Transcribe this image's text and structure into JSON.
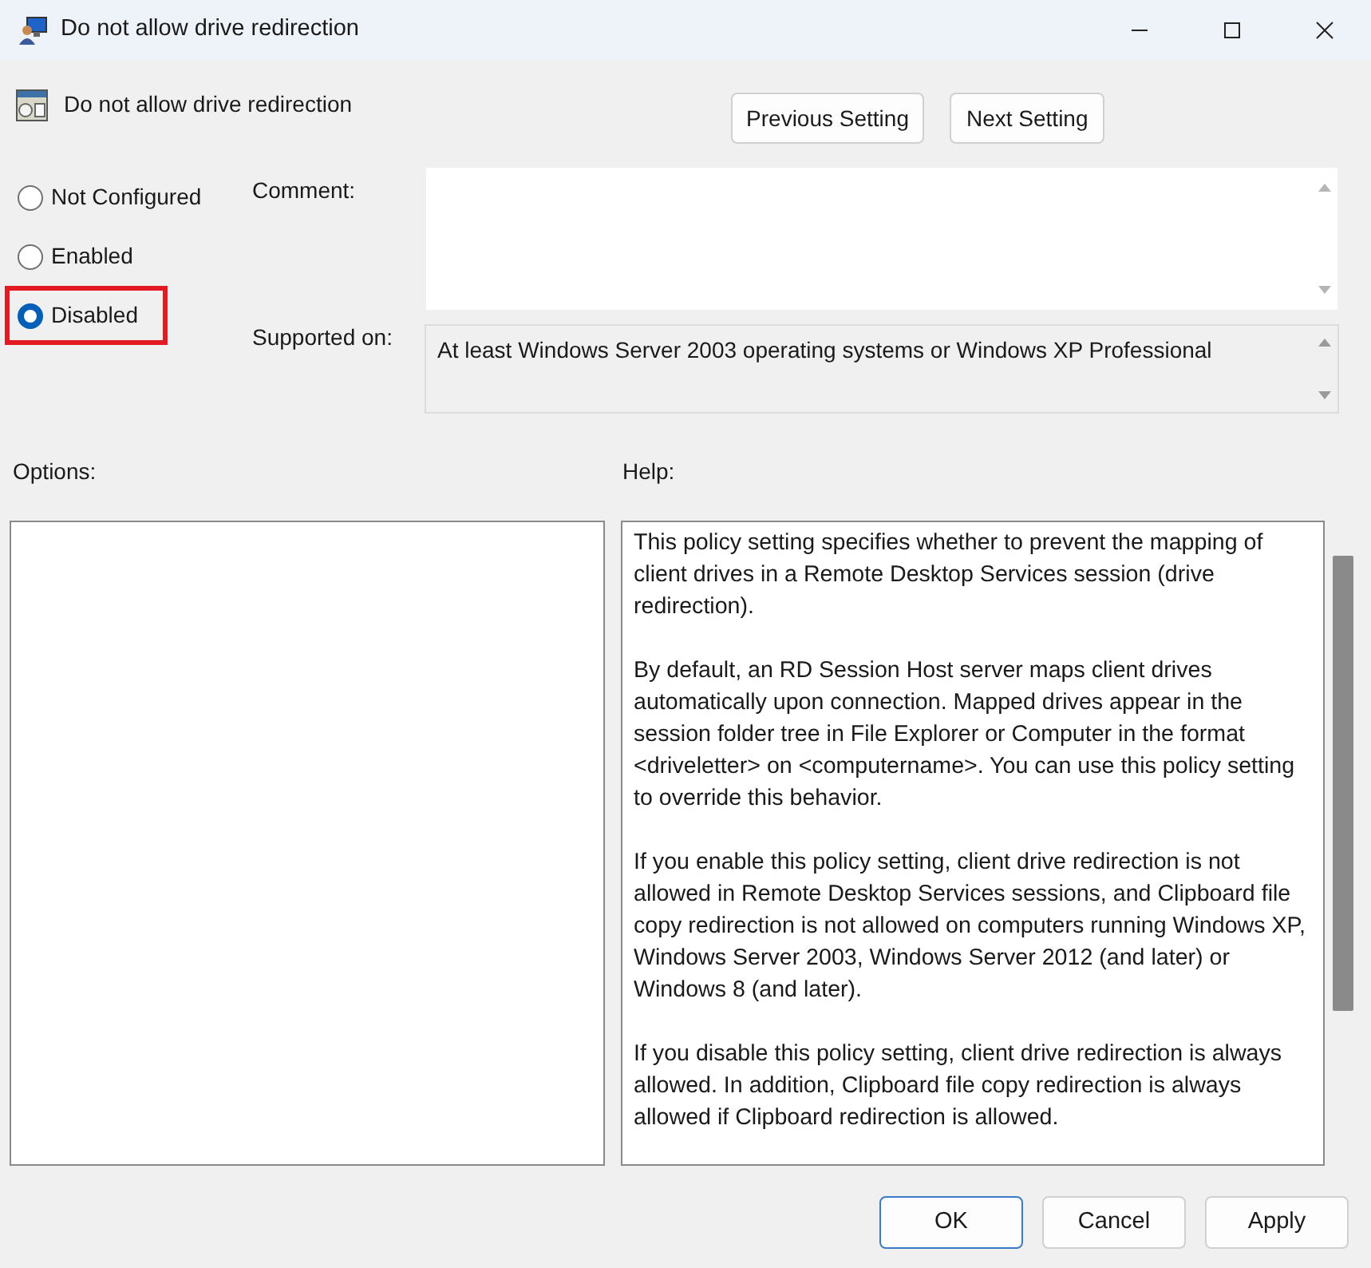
{
  "window": {
    "title": "Do not allow drive redirection",
    "controls": [
      {
        "kind": "minimize"
      },
      {
        "kind": "maximize"
      },
      {
        "kind": "close"
      }
    ]
  },
  "setting": {
    "title": "Do not allow drive redirection"
  },
  "nav_buttons": [
    "Previous Setting",
    "Next Setting"
  ],
  "state_options": [
    {
      "label": "Not Configured",
      "selected": false,
      "highlighted": false
    },
    {
      "label": "Enabled",
      "selected": false,
      "highlighted": false
    },
    {
      "label": "Disabled",
      "selected": true,
      "highlighted": true
    }
  ],
  "comment": {
    "label": "Comment:"
  },
  "supported_on": {
    "label": "Supported on:",
    "value": "At least Windows Server 2003 operating systems or Windows XP Professional"
  },
  "options": {
    "label": "Options:"
  },
  "help": {
    "label": "Help:",
    "paragraphs": [
      "This policy setting specifies whether to prevent the mapping of client drives in a Remote Desktop Services session (drive redirection).",
      "By default, an RD Session Host server maps client drives automatically upon connection. Mapped drives appear in the session folder tree in File Explorer or Computer in the format <driveletter> on <computername>. You can use this policy setting to override this behavior.",
      "If you enable this policy setting, client drive redirection is not allowed in Remote Desktop Services sessions, and Clipboard file copy redirection is not allowed on computers running Windows XP, Windows Server 2003, Windows Server 2012 (and later) or Windows 8 (and later).",
      "If you disable this policy setting, client drive redirection is always allowed. In addition, Clipboard file copy redirection is always allowed if Clipboard redirection is allowed."
    ]
  },
  "dialog_buttons": [
    {
      "label": "OK",
      "default": true
    },
    {
      "label": "Cancel",
      "default": false
    },
    {
      "label": "Apply",
      "default": false
    }
  ]
}
